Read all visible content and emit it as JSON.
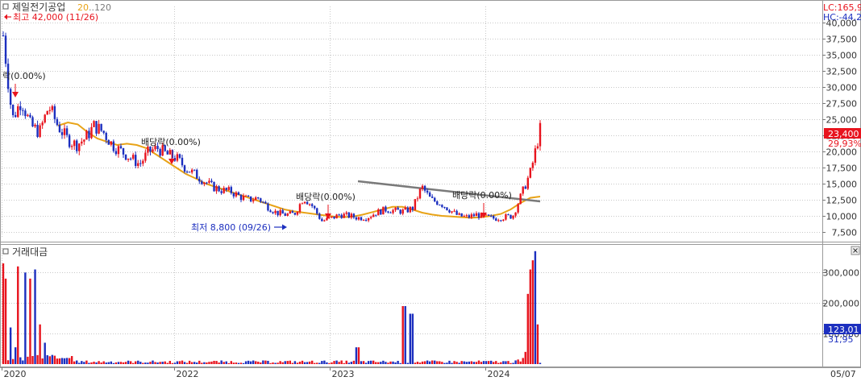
{
  "price_panel": {
    "title": "제일전기공업",
    "ma_short_label": "20",
    "ma_long_label": "120",
    "lc_label": "LC:165,9",
    "hc_label": "HC:-44,2",
    "high_marker": "최고 42,000 (11/26)",
    "low_marker": "최저 8,800 (09/26)",
    "current_price_badge": "23,400",
    "current_change_badge": "29,93%",
    "dividend_labels": [
      "락(0.00%)",
      "배당락(0.00%)",
      "배당락(0.00%)",
      "배당락(0.00%)"
    ],
    "y_ticks": [
      "40,000",
      "37,500",
      "35,000",
      "32,500",
      "30,000",
      "27,500",
      "25,000",
      "22,500",
      "20,000",
      "17,500",
      "15,000",
      "12,500",
      "10,000",
      "7,500"
    ]
  },
  "volume_panel": {
    "title": "거래대금",
    "y_ticks": [
      "300,000",
      "200,000",
      "100,000"
    ],
    "current_badge": "123,01",
    "current_sub_badge": "31,95"
  },
  "x_axis": {
    "labels": [
      "2020",
      "2022",
      "2023",
      "2024"
    ],
    "right_label": "05/07"
  },
  "colors": {
    "up": "#e8141e",
    "down": "#1c2fbf",
    "ma20": "#e8a317",
    "trend": "#7a7a7a",
    "grid": "#c8c8c8"
  },
  "chart_data": {
    "type": "candlestick",
    "x": [
      "2019-11",
      "2019-12",
      "2020-01",
      "2020-02",
      "2020-03",
      "2020-04",
      "2020-05",
      "2020-06",
      "2020-07",
      "2020-08",
      "2020-09",
      "2020-10",
      "2020-11",
      "2020-12",
      "2021-01",
      "2021-02",
      "2021-03",
      "2021-04",
      "2021-05",
      "2021-06",
      "2021-07",
      "2021-08",
      "2021-09",
      "2021-10",
      "2021-11",
      "2021-12",
      "2022-01",
      "2022-02",
      "2022-03",
      "2022-04",
      "2022-05",
      "2022-06",
      "2022-07",
      "2022-08",
      "2022-09",
      "2022-10",
      "2022-11",
      "2022-12",
      "2023-01",
      "2023-02",
      "2023-03",
      "2023-04",
      "2023-05",
      "2023-06",
      "2023-07",
      "2023-08",
      "2023-09",
      "2023-10",
      "2023-11",
      "2023-12",
      "2024-01",
      "2024-02",
      "2024-03",
      "2024-04",
      "2024-05"
    ],
    "close": [
      38000,
      25000,
      28000,
      24000,
      23000,
      27000,
      24000,
      22000,
      21000,
      22000,
      24000,
      23000,
      21000,
      20000,
      19000,
      18000,
      20000,
      20500,
      19500,
      19000,
      17500,
      16500,
      15500,
      14500,
      14000,
      13800,
      13000,
      12500,
      12800,
      11500,
      10500,
      10200,
      10300,
      12800,
      11500,
      9200,
      9600,
      10200,
      10000,
      9700,
      9800,
      10500,
      11000,
      10800,
      10700,
      11200,
      14500,
      12500,
      12000,
      11000,
      10000,
      9800,
      10200,
      9800,
      9600,
      9800,
      10000,
      13500,
      17000,
      23400
    ],
    "ma20": [
      null,
      null,
      null,
      24000,
      24500,
      24200,
      23000,
      22000,
      21500,
      21000,
      21200,
      21000,
      20500,
      19500,
      18500,
      17500,
      16500,
      15800,
      15000,
      14500,
      14000,
      13500,
      13000,
      12500,
      12000,
      11500,
      11000,
      10700,
      10500,
      10300,
      10100,
      9900,
      9800,
      9900,
      10200,
      10600,
      11000,
      11400,
      11400,
      11000,
      10500,
      10200,
      10000,
      9900,
      9800,
      9700,
      9800,
      10000,
      10300,
      11000,
      12000,
      12800,
      13000
    ],
    "trend_line": [
      [
        0.42,
        16000
      ],
      [
        0.63,
        13000
      ]
    ],
    "volume_ticks": [
      100000,
      200000,
      300000
    ],
    "y_ticks": [
      7500,
      10000,
      12500,
      15000,
      17500,
      20000,
      22500,
      25000,
      27500,
      30000,
      32500,
      35000,
      37500,
      40000
    ],
    "ylim": [
      6500,
      42500
    ]
  }
}
